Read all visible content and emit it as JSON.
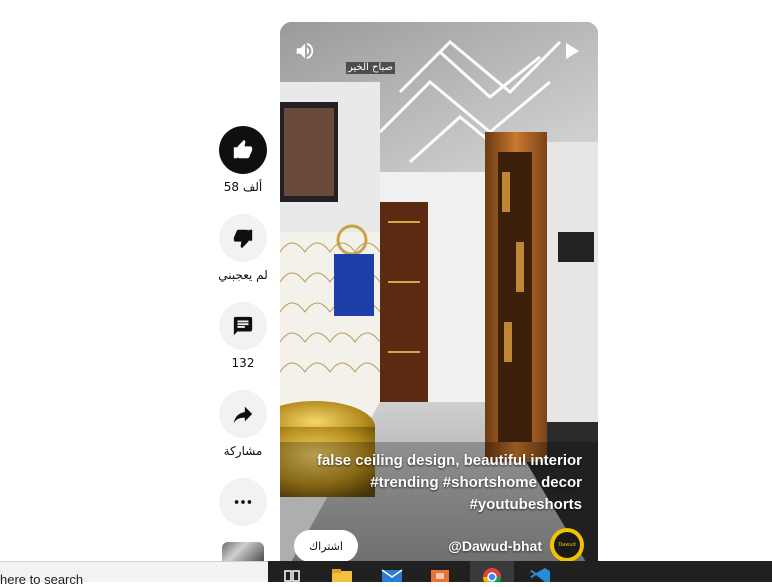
{
  "actions": {
    "like_count": "58 ألف",
    "dislike_label": "لم يعجبني",
    "comment_count": "132",
    "share_label": "مشاركة"
  },
  "video": {
    "overlay_text": "صباح الخير",
    "caption_line1": "false ceiling design, beautiful interior",
    "caption_tags_line2_a": "#trending",
    "caption_tags_line2_b": "#shorts",
    "caption_line2_c": "home decor",
    "caption_line3": "#youtubeshorts",
    "channel_name": "@Dawud-bhat",
    "subscribe_label": "اشتراك",
    "avatar_text": "Dawud"
  },
  "taskbar": {
    "search_text": "here to search"
  },
  "icons": [
    "like-icon",
    "dislike-icon",
    "comment-icon",
    "share-icon",
    "more-icon",
    "volume-icon",
    "play-icon",
    "task-view-icon",
    "file-explorer-icon",
    "mail-icon",
    "store-icon",
    "chrome-icon",
    "vscode-icon"
  ],
  "colors": {
    "like_bg": "#0f0f0f",
    "action_bg": "#f2f2f2",
    "avatar": "#f3c300",
    "taskbar": "#202020"
  }
}
